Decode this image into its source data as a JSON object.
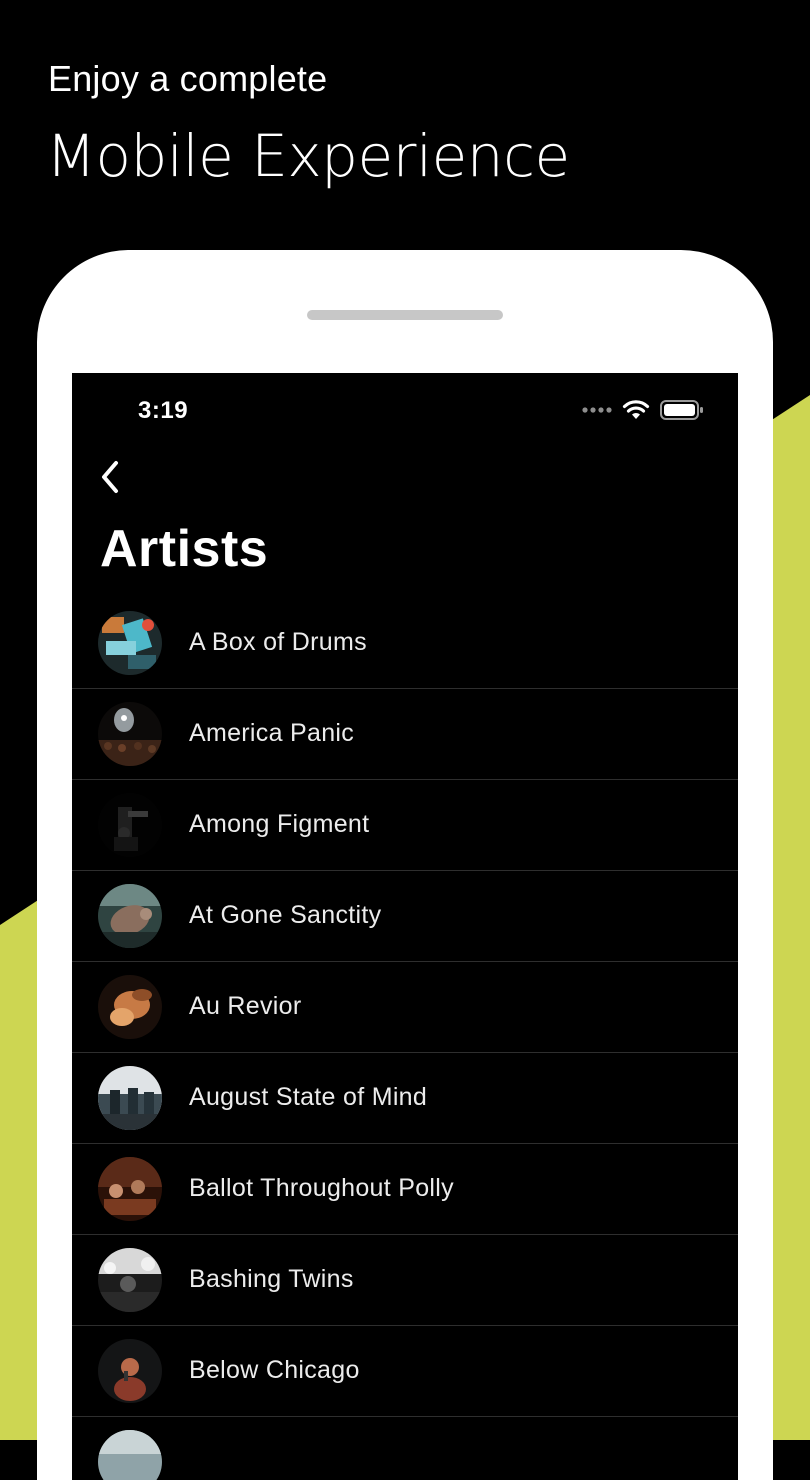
{
  "promo": {
    "line1": "Enjoy a complete",
    "line2": "Mobile Experience"
  },
  "colors": {
    "background": "#000000",
    "accent": "#cdd652",
    "device": "#ffffff"
  },
  "status_bar": {
    "time": "3:19",
    "icons": [
      "signal-dots-icon",
      "wifi-icon",
      "battery-icon"
    ]
  },
  "nav": {
    "back_icon": "chevron-left-icon"
  },
  "page": {
    "title": "Artists"
  },
  "artists": [
    {
      "name": "A Box of Drums"
    },
    {
      "name": "America Panic"
    },
    {
      "name": "Among Figment"
    },
    {
      "name": "At Gone Sanctity"
    },
    {
      "name": "Au Revior"
    },
    {
      "name": "August State of Mind"
    },
    {
      "name": "Ballot Throughout Polly"
    },
    {
      "name": "Bashing Twins"
    },
    {
      "name": "Below Chicago"
    },
    {
      "name": ""
    }
  ]
}
